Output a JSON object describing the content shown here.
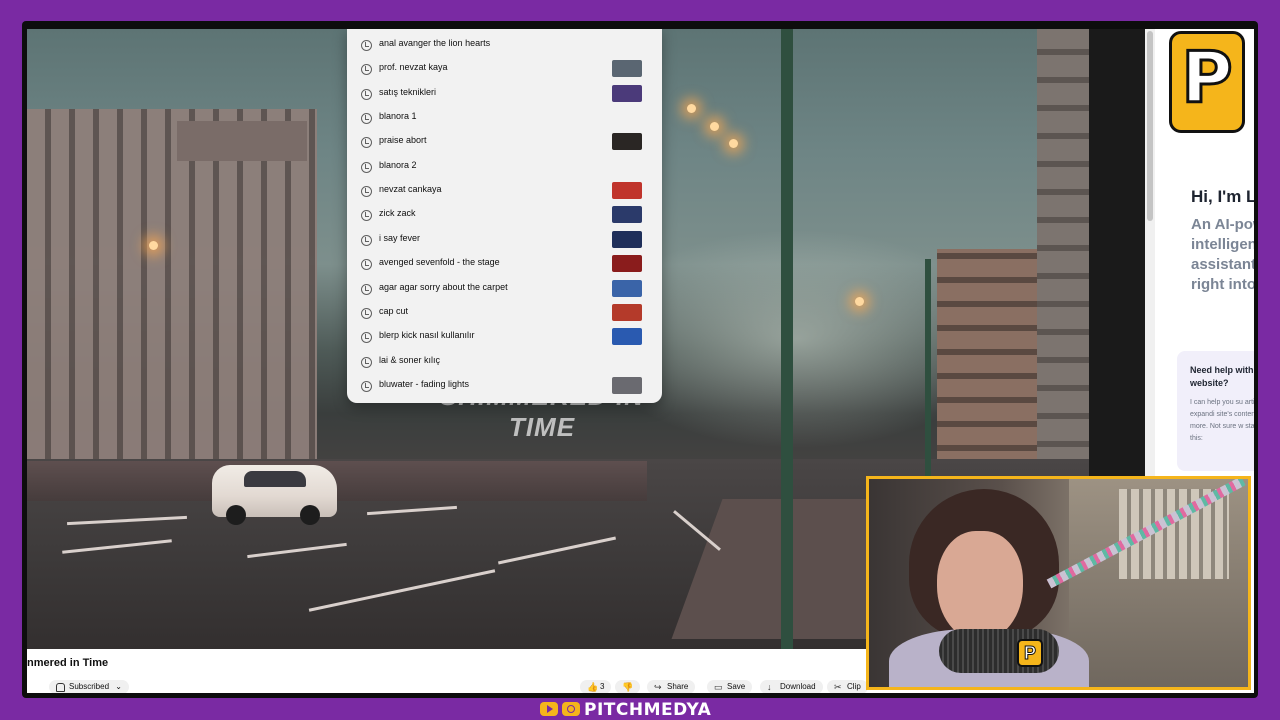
{
  "search_suggestions": [
    {
      "text": "anal avanger the lion hearts",
      "thumb": null
    },
    {
      "text": "prof. nevzat kaya",
      "thumb": "#5a6672"
    },
    {
      "text": "satış teknikleri",
      "thumb": "#4b3a7a"
    },
    {
      "text": "blanora 1",
      "thumb": null
    },
    {
      "text": "praise abort",
      "thumb": "#2a2624"
    },
    {
      "text": "blanora 2",
      "thumb": null
    },
    {
      "text": "nevzat cankaya",
      "thumb": "#c0342c"
    },
    {
      "text": "zick zack",
      "thumb": "#2b3a6a"
    },
    {
      "text": "i say fever",
      "thumb": "#1f2f5a"
    },
    {
      "text": "avenged sevenfold - the stage",
      "thumb": "#8a1c1c"
    },
    {
      "text": "agar agar sorry about the carpet",
      "thumb": "#3a64a8"
    },
    {
      "text": "cap cut",
      "thumb": "#b43a2a"
    },
    {
      "text": "blerp kick nasıl kullanılır",
      "thumb": "#2a5ab0"
    },
    {
      "text": "lai & soner kılıç",
      "thumb": null
    },
    {
      "text": "bluwater - fading lights",
      "thumb": "#6a6a70"
    }
  ],
  "video": {
    "overlay_caption": "SHIMMERED IN TIME",
    "title": "nmered in Time"
  },
  "actions": {
    "subscribed": "Subscribed",
    "likes": "3",
    "share": "Share",
    "save": "Save",
    "download": "Download",
    "clip": "Clip"
  },
  "sidebar": {
    "logo_letter": "P",
    "greeting": "Hi, I'm L",
    "description": "An AI-powered intelligent assistant built right into Bra",
    "card_title": "Need help with website?",
    "card_body": "I can help you su articles, expandi site's content and more. Not sure w start? Try this:"
  },
  "webcam": {
    "badge_letter": "P"
  },
  "brand": {
    "name": "PITCHMEDYA"
  },
  "colors": {
    "background": "#7a2aa3",
    "accent": "#f5b51b"
  }
}
